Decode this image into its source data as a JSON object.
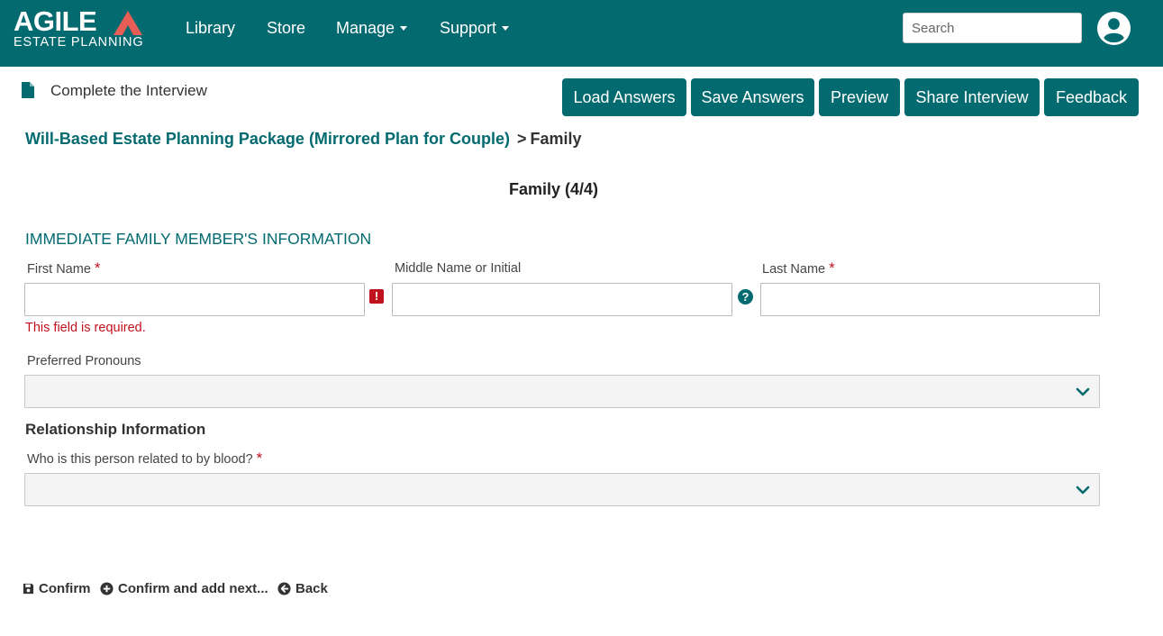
{
  "brand": {
    "logo_word": "AGILE",
    "logo_sub": "ESTATE PLANNING",
    "accent_color": "#036a70",
    "triangle_color": "#e85d56"
  },
  "nav": {
    "items": [
      {
        "label": "Library"
      },
      {
        "label": "Store"
      },
      {
        "label": "Manage"
      },
      {
        "label": "Support"
      }
    ],
    "search_placeholder": "Search",
    "user_icon": "user-circle-icon"
  },
  "header": {
    "title": "Complete the Interview",
    "buttons": [
      {
        "label": "Load Answers"
      },
      {
        "label": "Save Answers"
      },
      {
        "label": "Preview"
      },
      {
        "label": "Share Interview"
      },
      {
        "label": "Feedback"
      }
    ]
  },
  "breadcrumb": {
    "package": "Will-Based Estate Planning Package (Mirrored Plan for Couple)",
    "separator": ">",
    "current": "Family"
  },
  "step": {
    "title": "Family (4/4)"
  },
  "form": {
    "section_title": "IMMEDIATE FAMILY MEMBER'S INFORMATION",
    "required_marker": "*",
    "first_name": {
      "label": "First Name",
      "value": "",
      "error": "This field is required.",
      "error_icon": "!"
    },
    "middle_name": {
      "label": "Middle Name or Initial",
      "value": "",
      "help_icon": "?"
    },
    "last_name": {
      "label": "Last Name",
      "value": ""
    },
    "pronouns": {
      "label": "Preferred Pronouns",
      "selected": ""
    },
    "relationship_heading": "Relationship Information",
    "related_by_blood": {
      "label": "Who is this person related to by blood?",
      "selected": ""
    }
  },
  "actions": {
    "confirm": "Confirm",
    "confirm_next": "Confirm and add next...",
    "back": "Back"
  }
}
